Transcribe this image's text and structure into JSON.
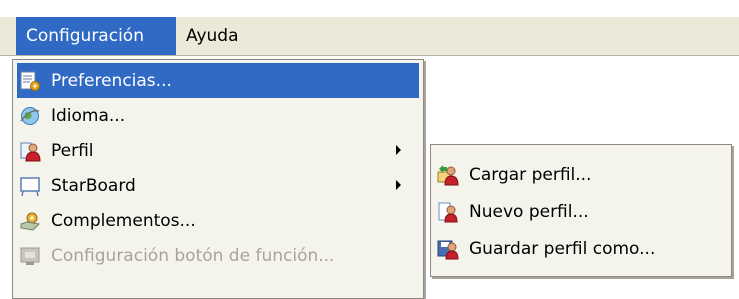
{
  "menubar": {
    "items": [
      {
        "label": "Configuración",
        "active": true
      },
      {
        "label": "Ayuda",
        "active": false
      }
    ]
  },
  "config_menu": {
    "items": [
      {
        "label": "Preferencias...",
        "icon": "preferences-icon",
        "highlighted": true,
        "submenu": false,
        "disabled": false
      },
      {
        "label": "Idioma...",
        "icon": "globe-icon",
        "highlighted": false,
        "submenu": false,
        "disabled": false
      },
      {
        "label": "Perfil",
        "icon": "profile-icon",
        "highlighted": false,
        "submenu": true,
        "disabled": false
      },
      {
        "label": "StarBoard",
        "icon": "starboard-icon",
        "highlighted": false,
        "submenu": true,
        "disabled": false
      },
      {
        "label": "Complementos...",
        "icon": "plugins-icon",
        "highlighted": false,
        "submenu": false,
        "disabled": false
      },
      {
        "label": "Configuración botón de función...",
        "icon": "function-button-icon",
        "highlighted": false,
        "submenu": false,
        "disabled": true
      }
    ]
  },
  "profile_submenu": {
    "items": [
      {
        "label": "Cargar perfil...",
        "icon": "load-profile-icon"
      },
      {
        "label": "Nuevo perfil...",
        "icon": "new-profile-icon"
      },
      {
        "label": "Guardar perfil como...",
        "icon": "save-profile-icon"
      }
    ]
  },
  "colors": {
    "highlight": "#316ac5",
    "menubar_bg": "#ece9d8",
    "menu_bg": "#f5f4ec",
    "disabled_text": "#a7a59b"
  }
}
